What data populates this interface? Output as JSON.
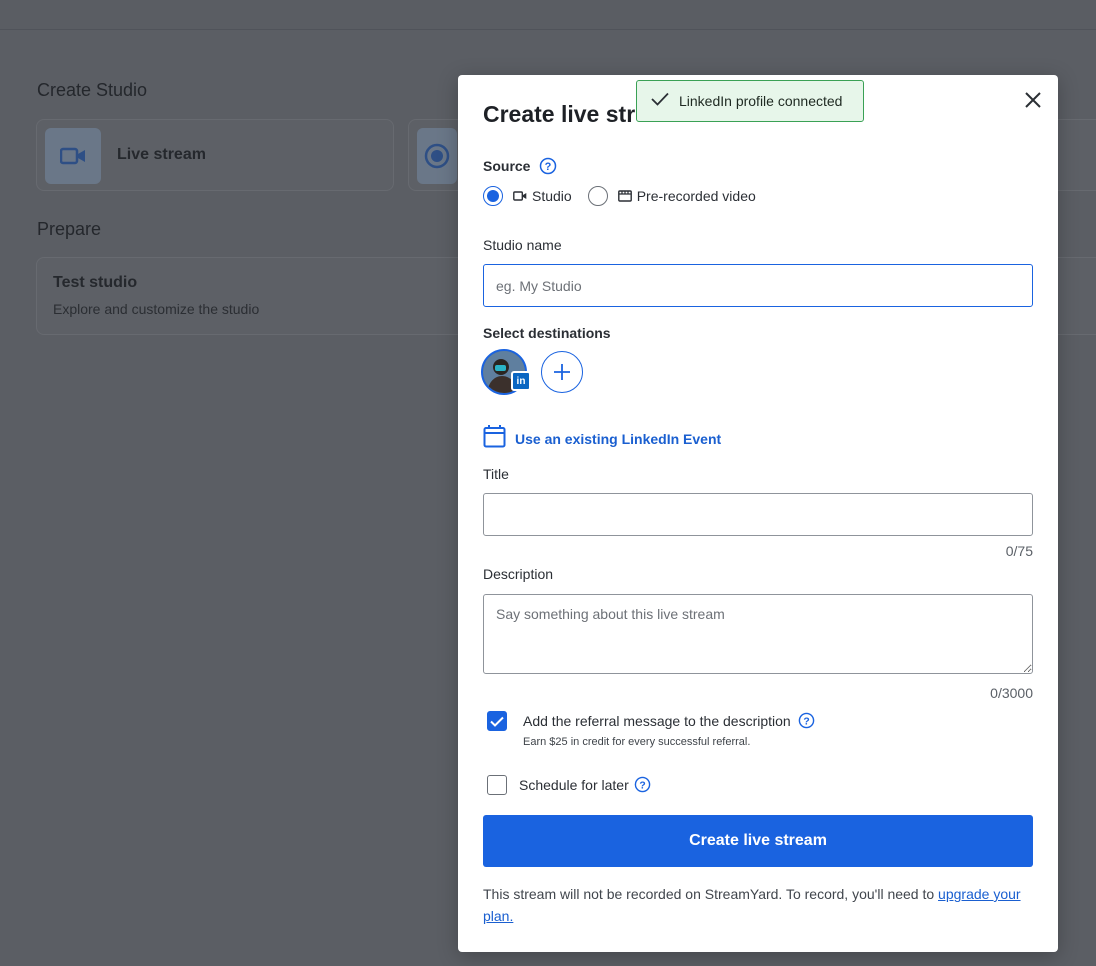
{
  "background": {
    "create_studio_heading": "Create Studio",
    "live_stream_card": "Live stream",
    "prepare_heading": "Prepare",
    "test_studio_title": "Test studio",
    "test_studio_desc": "Explore and customize the studio"
  },
  "toast": {
    "text": "LinkedIn profile connected",
    "icon": "check-icon"
  },
  "modal": {
    "title": "Create live stream",
    "source_label": "Source",
    "source_options": [
      {
        "label": "Studio",
        "icon": "camera-icon",
        "selected": true
      },
      {
        "label": "Pre-recorded video",
        "icon": "film-icon",
        "selected": false
      }
    ],
    "studio_name_label": "Studio name",
    "studio_name_placeholder": "eg. My Studio",
    "studio_name_value": "",
    "destinations_label": "Select destinations",
    "destination_badge": "in",
    "linkedin_event_link": "Use an existing LinkedIn Event",
    "title_label": "Title",
    "title_value": "",
    "title_counter": "0/75",
    "description_label": "Description",
    "description_placeholder": "Say something about this live stream",
    "description_counter": "0/3000",
    "referral_checkbox_label": "Add the referral message to the description",
    "referral_checked": true,
    "referral_sub": "Earn $25 in credit for every successful referral.",
    "schedule_label": "Schedule for later",
    "schedule_checked": false,
    "submit_label": "Create live stream",
    "footer_text": "This stream will not be recorded on StreamYard. To record, you'll need to ",
    "footer_link": "upgrade your plan."
  },
  "colors": {
    "accent": "#1a63e0",
    "linkedin": "#0a66c2",
    "toast_bg": "#e7f6ea",
    "toast_border": "#3aa155"
  }
}
